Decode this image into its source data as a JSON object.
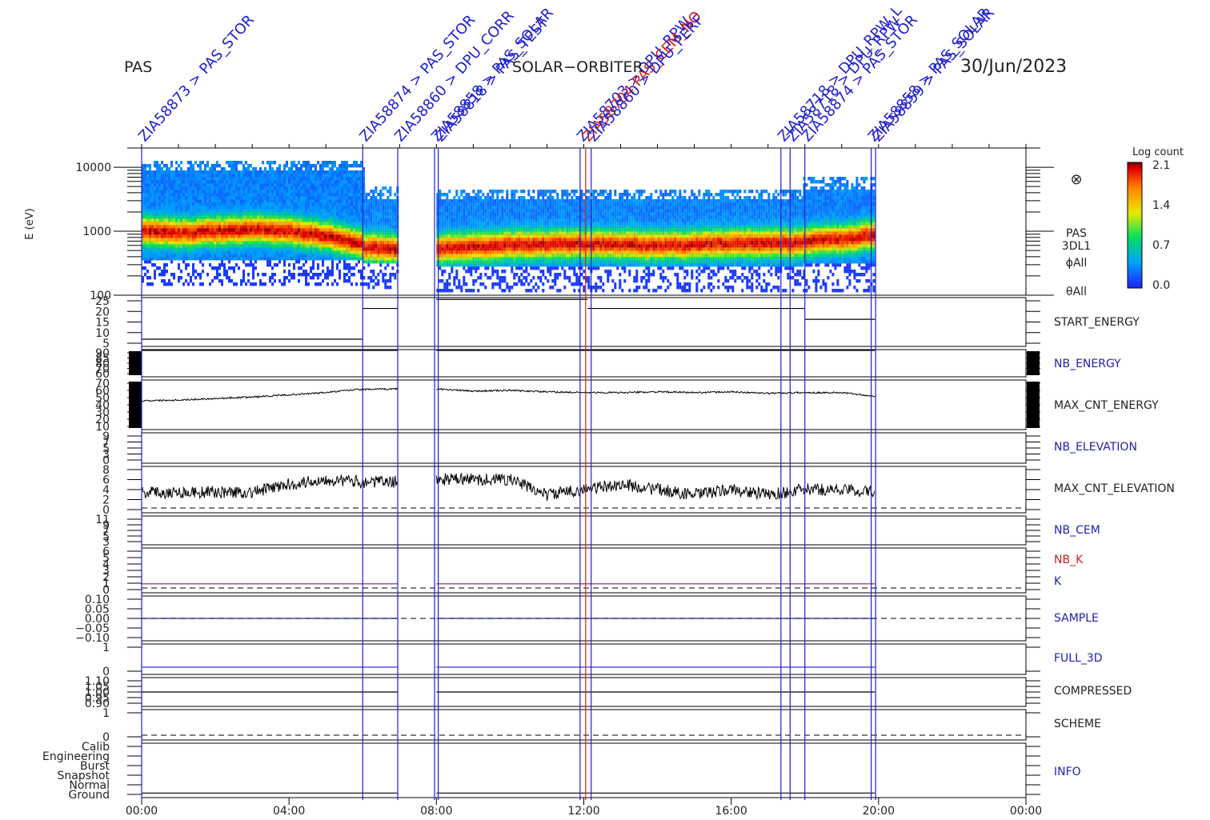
{
  "header": {
    "instrument": "PAS",
    "mission": "SOLAR−ORBITER",
    "date": "30/Jun/2023"
  },
  "colorbar": {
    "title": "Log count",
    "ticks": [
      "2.1",
      "1.4",
      "0.7",
      "0.0"
    ]
  },
  "spectrogram_info": {
    "symbol": "⊗",
    "lines": [
      "PAS",
      "3DL1",
      "ϕAll",
      "θAll"
    ]
  },
  "time_ticks": [
    "00:00",
    "04:00",
    "08:00",
    "12:00",
    "16:00",
    "20:00",
    "00:00"
  ],
  "colors": {
    "event_blue": "#1f1fd0",
    "event_red": "#d01f1f",
    "label_blue": "#1f1fb0",
    "label_red": "#c81e1e",
    "trace": "#000000",
    "k_line": "#8a1a5a"
  },
  "events": [
    {
      "hour": 0.0,
      "color": "blue",
      "label": "ZIA58873 > PAS_STOR"
    },
    {
      "hour": 6.0,
      "color": "blue",
      "label": "ZIA58874 > PAS_STOR"
    },
    {
      "hour": 6.95,
      "color": "blue",
      "label": "ZIA58860 > DPU_CORR"
    },
    {
      "hour": 7.95,
      "color": "blue",
      "label": "ZIA58858 > PAS_SOLAR"
    },
    {
      "hour": 8.05,
      "color": "blue",
      "label": "ZIA58818 > PAS_TEST"
    },
    {
      "hour": 11.9,
      "color": "blue",
      "label": "ZIA58703 > DPU_RPW"
    },
    {
      "hour": 12.05,
      "color": "red",
      "label": "ZIA58704 PAS_CEM_NO"
    },
    {
      "hour": 12.2,
      "color": "blue",
      "label": "ZIA58860 > DPU_PERF"
    },
    {
      "hour": 17.35,
      "color": "blue",
      "label": "ZIA58718 > DPU_RPW_L"
    },
    {
      "hour": 17.6,
      "color": "blue",
      "label": "ZIA58718 > DPU_RPW"
    },
    {
      "hour": 18.0,
      "color": "blue",
      "label": "ZIA58874 > PAS_STOR"
    },
    {
      "hour": 19.8,
      "color": "blue",
      "label": "ZIA58858 > PAS_SOLAR"
    },
    {
      "hour": 19.92,
      "color": "blue",
      "label": "ZIA58859 > PAS_SOLAR"
    }
  ],
  "chart_data": {
    "type": "heatmap",
    "title": "PAS",
    "subtitle": "SOLAR−ORBITER",
    "date": "30/Jun/2023",
    "x_unit": "UT hours",
    "xlim": [
      0,
      24
    ],
    "spectrogram": {
      "ylabel": "E (eV)",
      "yscale": "log",
      "ylim": [
        100,
        20000
      ],
      "yticks": [
        "10000",
        "1000",
        "100"
      ],
      "clim": [
        0.0,
        2.1
      ],
      "colorbar_label": "Log count",
      "data_intervals_hours": [
        [
          0.0,
          6.95
        ],
        [
          8.0,
          19.9
        ]
      ],
      "segments": [
        {
          "hours": [
            0.0,
            6.0
          ],
          "emin": 350,
          "emax": 13000,
          "peak_hours": [
            0,
            1,
            2,
            3,
            4,
            5,
            6
          ],
          "peak_energy": [
            1050,
            950,
            1000,
            1100,
            1000,
            850,
            620
          ]
        },
        {
          "hours": [
            6.0,
            6.95
          ],
          "emin": 330,
          "emax": 5000,
          "peak_hours": [
            6.0,
            6.95
          ],
          "peak_energy": [
            560,
            530
          ]
        },
        {
          "hours": [
            8.0,
            17.95
          ],
          "emin": 290,
          "emax": 4600,
          "peak_hours": [
            8,
            10,
            12,
            14,
            16,
            17.95
          ],
          "peak_energy": [
            540,
            620,
            640,
            600,
            650,
            660
          ]
        },
        {
          "hours": [
            17.95,
            19.9
          ],
          "emin": 300,
          "emax": 7000,
          "peak_hours": [
            18,
            19,
            19.9
          ],
          "peak_energy": [
            720,
            760,
            880
          ]
        }
      ]
    },
    "panels": [
      {
        "name": "START_ENERGY",
        "label_color": "black",
        "yticks": [
          "25",
          "20",
          "15",
          "10",
          "5"
        ],
        "ylim": [
          0,
          27
        ],
        "series": [
          {
            "x": [
              0.0,
              6.0
            ],
            "y": [
              4,
              4
            ]
          },
          {
            "x": [
              6.0,
              6.95
            ],
            "y": [
              21,
              21
            ]
          },
          {
            "x": [
              8.0,
              12.1
            ],
            "y": [
              26,
              26
            ]
          },
          {
            "x": [
              12.1,
              18.0
            ],
            "y": [
              21,
              21
            ]
          },
          {
            "x": [
              18.0,
              19.9
            ],
            "y": [
              15,
              15
            ]
          }
        ]
      },
      {
        "name": "NB_ENERGY",
        "label_color": "blue",
        "yticks": [
          "90",
          "85",
          "80",
          "70",
          "60"
        ],
        "ylim": [
          58,
          92
        ],
        "series": [
          {
            "x": [
              0.0,
              6.95
            ],
            "y": [
              96,
              96
            ]
          },
          {
            "x": [
              8.0,
              19.9
            ],
            "y": [
              96,
              96
            ]
          }
        ]
      },
      {
        "name": "MAX_CNT_ENERGY",
        "label_color": "black",
        "yticks": [
          "70",
          "60",
          "50",
          "40",
          "30",
          "20",
          "10"
        ],
        "ylim": [
          5,
          72
        ],
        "trace": {
          "x": [
            0,
            1,
            2,
            3,
            4,
            5,
            5.8,
            6.95,
            8,
            9,
            10,
            11,
            12,
            13,
            14,
            15,
            16,
            17,
            18,
            19,
            19.9
          ],
          "y": [
            44,
            45,
            47,
            49,
            52,
            55,
            59,
            60,
            60,
            57,
            58,
            56,
            55,
            55,
            56,
            55,
            56,
            54,
            55,
            55,
            50
          ]
        }
      },
      {
        "name": "NB_ELEVATION",
        "label_color": "blue",
        "yticks": [
          "9",
          "7",
          "5",
          "3",
          "0"
        ],
        "ylim": [
          0,
          10
        ],
        "series": []
      },
      {
        "name": "MAX_CNT_ELEVATION",
        "label_color": "black",
        "yticks": [
          "8",
          "6",
          "4",
          "2",
          "0"
        ],
        "ylim": [
          -0.5,
          8.5
        ],
        "trace": {
          "x": [
            0,
            3,
            4,
            5,
            6,
            6.95,
            8,
            10,
            11,
            13,
            14,
            15,
            16,
            17,
            18,
            19,
            19.9
          ],
          "y": [
            3.5,
            3.5,
            5,
            6,
            5.5,
            5.5,
            6,
            6,
            3,
            5,
            4,
            3,
            4,
            3,
            4,
            4,
            3.5
          ]
        }
      },
      {
        "name": "NB_CEM",
        "label_color": "blue",
        "yticks": [
          "11",
          "9",
          "7",
          "5",
          "3"
        ],
        "ylim": [
          2,
          12
        ],
        "series": []
      },
      {
        "name": "NB_K",
        "label_color": "red",
        "yticks": [
          "6",
          "5",
          "4",
          "3",
          "2",
          "1",
          "0"
        ],
        "ylim": [
          -0.5,
          7
        ],
        "series": [
          {
            "x": [
              0.0,
              6.95
            ],
            "y": [
              1,
              1
            ]
          },
          {
            "x": [
              8.0,
              19.9
            ],
            "y": [
              1,
              1
            ]
          }
        ]
      },
      {
        "name": "SAMPLE",
        "label_color": "blue",
        "yticks": [
          "0.10",
          "0.05",
          "0.00",
          "−0.05",
          "−0.10"
        ],
        "ylim": [
          -0.11,
          0.11
        ],
        "series": [
          {
            "x": [
              0.0,
              6.95
            ],
            "y": [
              0,
              0
            ]
          },
          {
            "x": [
              8.0,
              19.9
            ],
            "y": [
              0,
              0
            ]
          }
        ]
      },
      {
        "name": "FULL_3D",
        "label_color": "blue",
        "yticks": [
          "1",
          "0"
        ],
        "ylim": [
          -0.5,
          1.6
        ],
        "series": [
          {
            "x": [
              0.0,
              6.95
            ],
            "y": [
              0,
              0
            ]
          },
          {
            "x": [
              8.0,
              19.9
            ],
            "y": [
              0,
              0
            ]
          }
        ]
      },
      {
        "name": "COMPRESSED",
        "label_color": "black",
        "yticks": [
          "1.10",
          "1.05",
          "1.00",
          "0.95",
          "0.90"
        ],
        "ylim": [
          0.88,
          1.12
        ],
        "series": [
          {
            "x": [
              0.0,
              6.95
            ],
            "y": [
              1,
              1
            ]
          },
          {
            "x": [
              8.0,
              19.9
            ],
            "y": [
              1,
              1
            ]
          }
        ]
      },
      {
        "name": "SCHEME",
        "label_color": "black",
        "yticks": [
          "1",
          "0"
        ],
        "ylim": [
          -0.4,
          1.6
        ],
        "series": []
      },
      {
        "name": "INFO",
        "label_color": "blue",
        "yticks": [
          "Calib",
          "Engineering",
          "Burst",
          "Snapshot",
          "Normal",
          "Ground"
        ],
        "ylim": [
          0,
          6
        ],
        "series": [
          {
            "x": [
              0.0,
              6.95
            ],
            "y": [
              0.5,
              0.5
            ]
          },
          {
            "x": [
              8.0,
              19.9
            ],
            "y": [
              0.5,
              0.5
            ]
          }
        ]
      }
    ],
    "k_label": "K"
  }
}
